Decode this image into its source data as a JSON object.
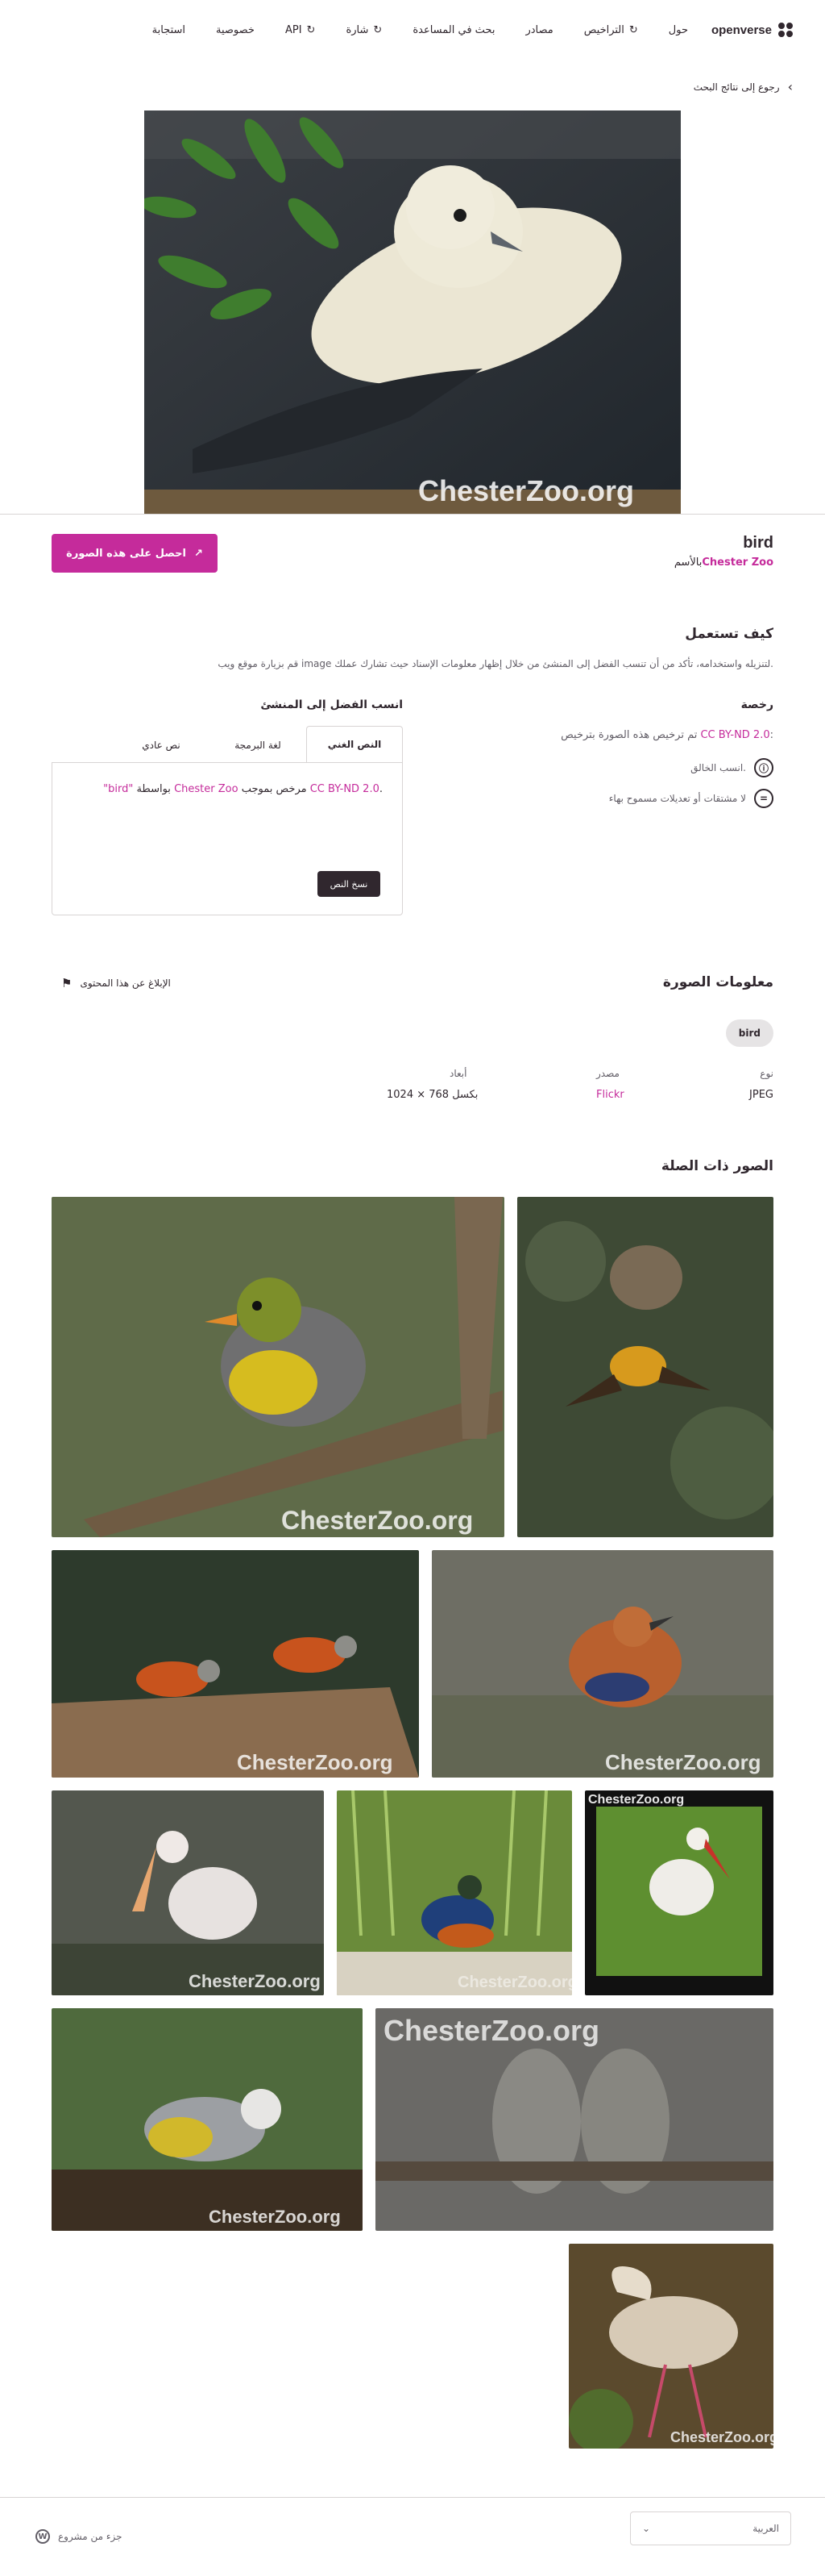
{
  "header": {
    "logo": "openverse",
    "nav": [
      {
        "label": "حول",
        "icon": ""
      },
      {
        "label": "التراخيص",
        "icon": "refresh-icon"
      },
      {
        "label": "مصادر",
        "icon": ""
      },
      {
        "label": "بحث في المساعدة",
        "icon": ""
      },
      {
        "label": "شارة",
        "icon": "refresh-icon"
      },
      {
        "label": "API",
        "icon": "refresh-icon"
      },
      {
        "label": "خصوصية",
        "icon": ""
      },
      {
        "label": "استجابة",
        "icon": ""
      }
    ]
  },
  "back_link": "رجوع إلى نتائج البحث",
  "image": {
    "title": "bird",
    "by_prefix": "بالأسم",
    "creator": "Chester Zoo",
    "watermark": "ChesterZoo.org",
    "get_button": "احصل على هذه الصورة"
  },
  "how_to_use": {
    "heading": "كيف تستعمل",
    "description": "قم بزيارة موقع ويب image لتنزيله واستخدامه، تأكد من أن تنسب الفضل إلى المنشئ من خلال إظهار معلومات الإسناد حيث تشارك عملك."
  },
  "license": {
    "heading": "رخصة",
    "line_prefix": "تم ترخيص هذه الصورة بترخيص",
    "license_name": "CC BY-ND 2.0",
    "line_suffix": ":",
    "terms": [
      {
        "icon": "by-icon",
        "glyph": "ⓘ",
        "text": "انسب الخالق."
      },
      {
        "icon": "nd-icon",
        "glyph": "=",
        "text": "لا مشتقات أو تعديلات مسموح بهاء"
      }
    ]
  },
  "attribution": {
    "heading": "انسب الفضل إلى المنشئ",
    "tabs": [
      "النص الغني",
      "لغة البرمجة",
      "نص عادي"
    ],
    "text_quote": "\"bird\"",
    "text_by": " بواسطة ",
    "text_creator": "Chester Zoo",
    "text_licensed": " مرخص بموجب ",
    "text_license": "CC BY-ND 2.0",
    "text_end": ".",
    "copy_button": "نسخ النص"
  },
  "info": {
    "heading": "معلومات الصورة",
    "report": "الإبلاغ عن هذا المحتوى",
    "tag": "bird",
    "type_label": "نوع",
    "type_value": "JPEG",
    "source_label": "مصدر",
    "source_value": "Flickr",
    "dims_label": "أبعاد",
    "dims_value": "1024 × 768 بكسل"
  },
  "related": {
    "heading": "الصور ذات الصلة"
  },
  "footer": {
    "language": "العربية",
    "brand": "جزء من مشروع"
  },
  "colors": {
    "accent": "#c52b9b",
    "text": "#30272e",
    "muted": "#615d66",
    "border": "#d8d4d4"
  }
}
